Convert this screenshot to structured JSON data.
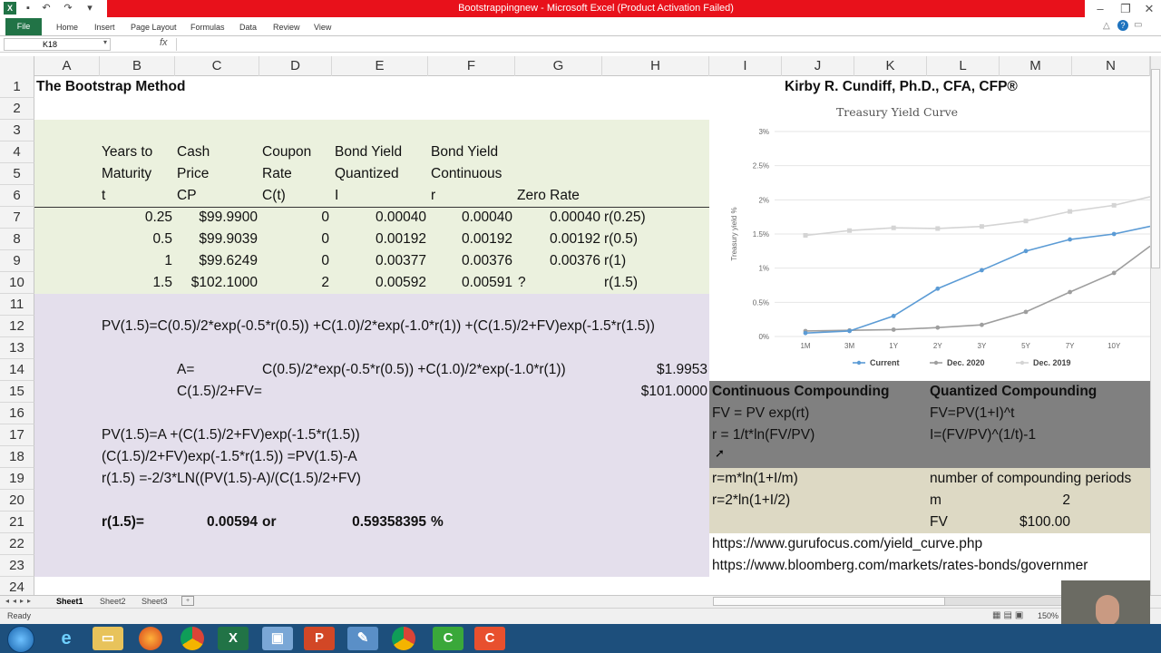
{
  "window": {
    "title": "Bootstrappingnew - Microsoft Excel (Product Activation Failed)"
  },
  "ribbon": {
    "tabs": [
      "File",
      "Home",
      "Insert",
      "Page Layout",
      "Formulas",
      "Data",
      "Review",
      "View"
    ]
  },
  "formula_bar": {
    "name_box": "K18",
    "fx": "fx",
    "value": ""
  },
  "columns": [
    "A",
    "B",
    "C",
    "D",
    "E",
    "F",
    "G",
    "H",
    "I",
    "J",
    "K",
    "L",
    "M",
    "N"
  ],
  "rows": [
    "1",
    "2",
    "3",
    "4",
    "5",
    "6",
    "7",
    "8",
    "9",
    "10",
    "11",
    "12",
    "13",
    "14",
    "15",
    "16",
    "17",
    "18",
    "19",
    "20",
    "21",
    "22",
    "23",
    "24"
  ],
  "cells": {
    "A1": "The Bootstrap Method",
    "J1": "Kirby R. Cundiff, Ph.D., CFA, CFP®",
    "B4": "Years to",
    "B5": "Maturity",
    "B6": "t",
    "C4": "Cash",
    "C5": "Price",
    "C6": "CP",
    "D4": "Coupon",
    "D5": "Rate",
    "D6": "C(t)",
    "E4": "Bond Yield",
    "E5": "Quantized",
    "E6": "I",
    "F4": "Bond Yield",
    "F5": "Continuous",
    "F6": "r",
    "G6": "Zero Rate",
    "table": [
      [
        "0.25",
        "$99.9900",
        "0",
        "0.00040",
        "0.00040",
        "0.00040",
        "r(0.25)"
      ],
      [
        "0.5",
        "$99.9039",
        "0",
        "0.00192",
        "0.00192",
        "0.00192",
        "r(0.5)"
      ],
      [
        "1",
        "$99.6249",
        "0",
        "0.00377",
        "0.00376",
        "0.00376",
        "r(1)"
      ],
      [
        "1.5",
        "$102.1000",
        "2",
        "0.00592",
        "0.00591",
        "?",
        "r(1.5)"
      ]
    ],
    "B12": "PV(1.5)=C(0.5)/2*exp(-0.5*r(0.5)) +C(1.0)/2*exp(-1.0*r(1)) +(C(1.5)/2+FV)exp(-1.5*r(1.5))",
    "C14": "A=",
    "D14": "C(0.5)/2*exp(-0.5*r(0.5)) +C(1.0)/2*exp(-1.0*r(1))",
    "H14": "$1.9953",
    "C15": "C(1.5)/2+FV=",
    "H15": "$101.0000",
    "B17": "PV(1.5)=A +(C(1.5)/2+FV)exp(-1.5*r(1.5))",
    "B18": "(C(1.5)/2+FV)exp(-1.5*r(1.5)) =PV(1.5)-A",
    "B19": "r(1.5) =-2/3*LN((PV(1.5)-A)/(C(1.5)/2+FV)",
    "B21": "r(1.5)=",
    "C21": "0.00594",
    "D21": "or",
    "E21": "0.59358395",
    "F21": "%",
    "I14": "Continuous Compounding",
    "L14": "Quantized Compounding",
    "I15": "FV = PV exp(rt)",
    "L15": "FV=PV(1+I)^t",
    "I16": "r = 1/t*ln(FV/PV)",
    "L16": "I=(FV/PV)^(1/t)-1",
    "I19": "r=m*ln(1+I/m)",
    "L19": "number of compounding periods",
    "I20": "r=2*ln(1+I/2)",
    "L20": "m",
    "M20": "2",
    "L21": "FV",
    "M21": "$100.00",
    "I22": "https://www.gurufocus.com/yield_curve.php",
    "I23": "https://www.bloomberg.com/markets/rates-bonds/governmer"
  },
  "sheets": [
    "Sheet1",
    "Sheet2",
    "Sheet3"
  ],
  "status": {
    "ready": "Ready",
    "zoom": "150%"
  },
  "chart_data": {
    "type": "line",
    "title": "Treasury Yield Curve",
    "ylabel": "Treasury yield %",
    "categories": [
      "1M",
      "3M",
      "1Y",
      "2Y",
      "3Y",
      "5Y",
      "7Y",
      "10Y"
    ],
    "yticks": [
      "0%",
      "0.5%",
      "1%",
      "1.5%",
      "2%",
      "2.5%",
      "3%"
    ],
    "ylim": [
      0,
      3
    ],
    "legend_position": "bottom",
    "series": [
      {
        "name": "Current",
        "color": "#5b9bd5",
        "values": [
          0.05,
          0.08,
          0.3,
          0.7,
          0.97,
          1.25,
          1.42,
          1.5
        ]
      },
      {
        "name": "Dec. 2020",
        "color": "#9e9e9e",
        "values": [
          0.08,
          0.09,
          0.1,
          0.13,
          0.17,
          0.36,
          0.65,
          0.93
        ]
      },
      {
        "name": "Dec. 2019",
        "color": "#d4d4d4",
        "values": [
          1.48,
          1.55,
          1.59,
          1.58,
          1.61,
          1.69,
          1.83,
          1.92
        ]
      }
    ]
  },
  "taskbar": {
    "icons": [
      "start-orb",
      "internet-explorer",
      "file-explorer",
      "firefox",
      "chrome",
      "excel",
      "remote-desktop",
      "powerpoint",
      "paint",
      "chrome-2",
      "camtasia-recorder",
      "camtasia-editor"
    ]
  }
}
